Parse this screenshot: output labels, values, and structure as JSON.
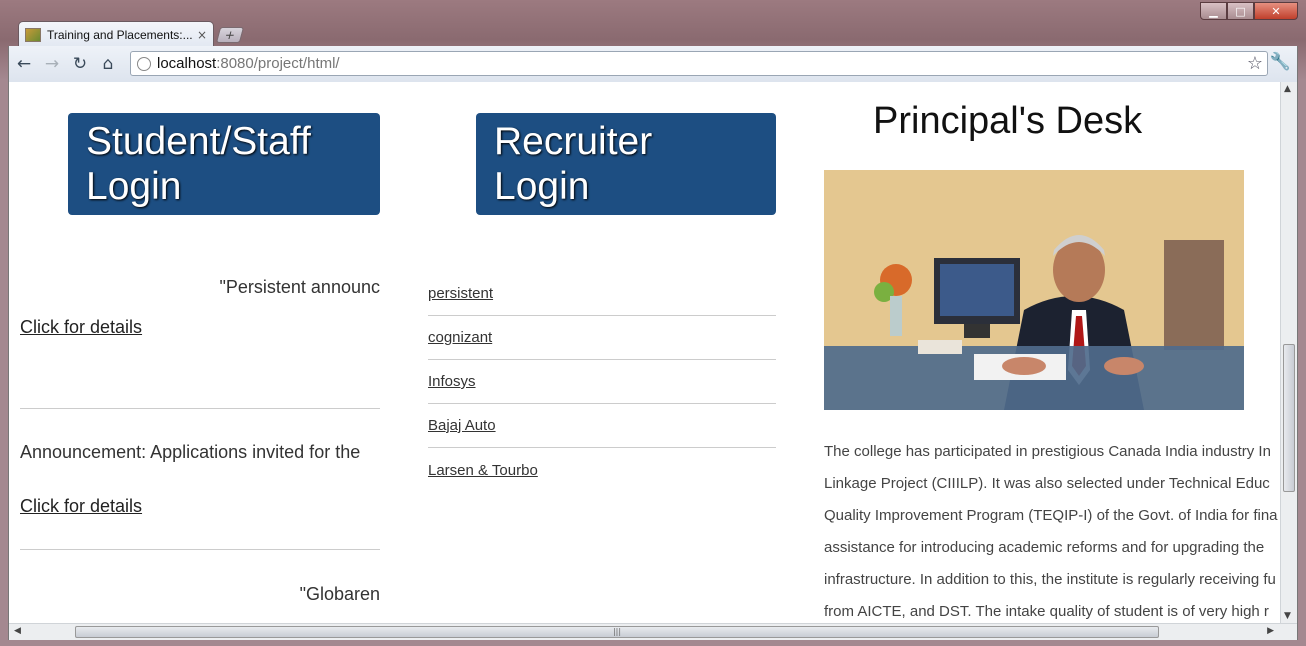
{
  "browser": {
    "tab_title": "Training and Placements:...",
    "tab_close": "×",
    "new_tab": "+",
    "url_host": "localhost",
    "url_rest": ":8080/project/html/",
    "win_min": "▁",
    "win_max": "□",
    "win_close": "✕"
  },
  "logins": {
    "student_staff": "Student/Staff Login",
    "recruiter": "Recruiter Login"
  },
  "announcements": [
    {
      "text": "\"Persistent announc",
      "link": "Click for details"
    },
    {
      "text": "Announcement: Applications invited for the",
      "link": "Click for details"
    },
    {
      "text": "\"Globaren"
    }
  ],
  "companies": [
    "persistent",
    "cognizant",
    "Infosys",
    "Bajaj Auto",
    "Larsen & Tourbo"
  ],
  "principal": {
    "title": "Principal's Desk",
    "lines": [
      "The college has participated in prestigious Canada India industry In",
      "Linkage Project (CIIILP). It was also selected under Technical Educ",
      "Quality Improvement Program (TEQIP-I) of the Govt. of India for fina",
      "assistance for introducing academic reforms and for upgrading the",
      "infrastructure. In addition to this, the institute is regularly receiving fu",
      "from AICTE, and DST. The intake quality of student is of very high r"
    ]
  }
}
